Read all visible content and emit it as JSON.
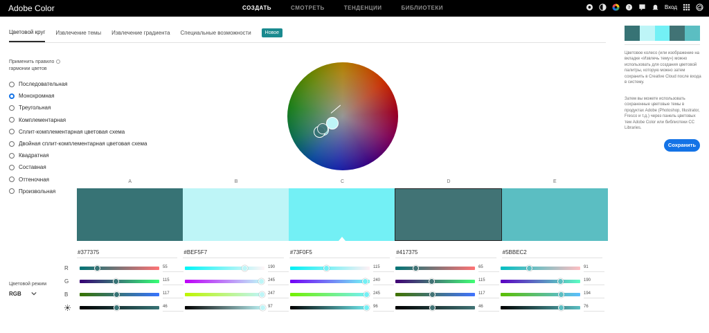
{
  "topbar": {
    "brand": "Adobe Color",
    "nav": [
      "СОЗДАТЬ",
      "СМОТРЕТЬ",
      "ТЕНДЕНЦИИ",
      "БИБЛИОТЕКИ"
    ],
    "login": "Вход"
  },
  "tabs": [
    "Цветовой круг",
    "Извлечение темы",
    "Извлечение градиента",
    "Специальные возможности"
  ],
  "tab_badge": "Новое",
  "harmony": {
    "title": "Применить правило гармонии цветов",
    "rules": [
      "Последовательная",
      "Монохромная",
      "Треугольная",
      "Комплементарная",
      "Сплит-комплементарная цветовая схема",
      "Двойная сплит-комплементарная цветовая схема",
      "Квадратная",
      "Составная",
      "Оттеночная",
      "Произвольная"
    ],
    "selected": 1
  },
  "swatches": {
    "letters": [
      "A",
      "B",
      "C",
      "D",
      "E"
    ],
    "colors": [
      "#377375",
      "#BEF5F7",
      "#73F0F5",
      "#417375",
      "#5BBEC2"
    ],
    "hex": [
      "#377375",
      "#BEF5F7",
      "#73F0F5",
      "#417375",
      "#5BBEC2"
    ],
    "selected_index": 2,
    "outlined_index": 3
  },
  "channels": {
    "labels": [
      "R",
      "G",
      "B"
    ],
    "brightness_icon": "sun-icon"
  },
  "rgb_values": [
    [
      55,
      115,
      117,
      46
    ],
    [
      190,
      245,
      247,
      97
    ],
    [
      115,
      240,
      245,
      96
    ],
    [
      65,
      115,
      117,
      46
    ],
    [
      91,
      190,
      194,
      76
    ]
  ],
  "color_mode": {
    "label": "Цветовой режим",
    "value": "RGB"
  },
  "side": {
    "desc1": "Цветовое колесо (или изображение на вкладке «Извлечь тему») можно использовать для создания цветовой палитры, которую можно затем сохранить в Creative Cloud после входа в систему.",
    "desc2": "Затем вы можете использовать сохраненные цветовые темы в продуктах Adobe (Photoshop, Illustrator, Fresco и т.д.) через панель цветовых тем Adobe Color или библиотеки CC Libraries.",
    "save_label": "Сохранить"
  }
}
